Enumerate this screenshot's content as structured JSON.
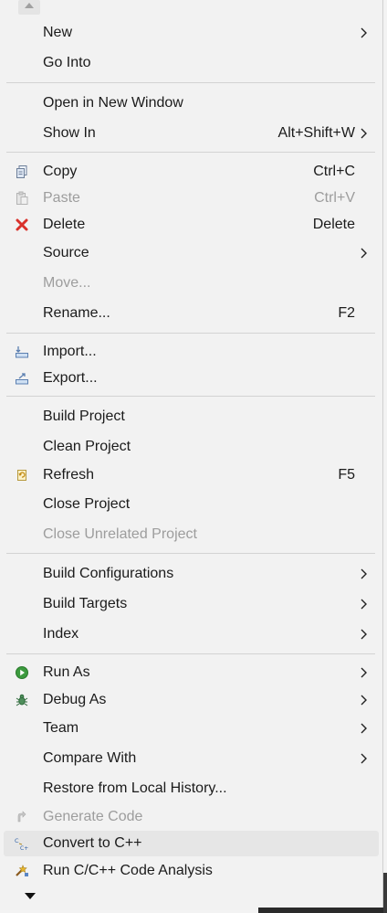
{
  "menu": {
    "items": [
      {
        "label": "New",
        "shortcut": "",
        "submenu": true,
        "disabled": false,
        "icon": ""
      },
      {
        "label": "Go Into",
        "shortcut": "",
        "submenu": false,
        "disabled": false,
        "icon": ""
      },
      {
        "label": "Open in New Window",
        "shortcut": "",
        "submenu": false,
        "disabled": false,
        "icon": ""
      },
      {
        "label": "Show In",
        "shortcut": "Alt+Shift+W",
        "submenu": true,
        "disabled": false,
        "icon": ""
      },
      {
        "label": "Copy",
        "shortcut": "Ctrl+C",
        "submenu": false,
        "disabled": false,
        "icon": "copy-icon"
      },
      {
        "label": "Paste",
        "shortcut": "Ctrl+V",
        "submenu": false,
        "disabled": true,
        "icon": "paste-icon"
      },
      {
        "label": "Delete",
        "shortcut": "Delete",
        "submenu": false,
        "disabled": false,
        "icon": "delete-icon"
      },
      {
        "label": "Source",
        "shortcut": "",
        "submenu": true,
        "disabled": false,
        "icon": ""
      },
      {
        "label": "Move...",
        "shortcut": "",
        "submenu": false,
        "disabled": true,
        "icon": ""
      },
      {
        "label": "Rename...",
        "shortcut": "F2",
        "submenu": false,
        "disabled": false,
        "icon": ""
      },
      {
        "label": "Import...",
        "shortcut": "",
        "submenu": false,
        "disabled": false,
        "icon": "import-icon"
      },
      {
        "label": "Export...",
        "shortcut": "",
        "submenu": false,
        "disabled": false,
        "icon": "export-icon"
      },
      {
        "label": "Build Project",
        "shortcut": "",
        "submenu": false,
        "disabled": false,
        "icon": ""
      },
      {
        "label": "Clean Project",
        "shortcut": "",
        "submenu": false,
        "disabled": false,
        "icon": ""
      },
      {
        "label": "Refresh",
        "shortcut": "F5",
        "submenu": false,
        "disabled": false,
        "icon": "refresh-icon"
      },
      {
        "label": "Close Project",
        "shortcut": "",
        "submenu": false,
        "disabled": false,
        "icon": ""
      },
      {
        "label": "Close Unrelated Project",
        "shortcut": "",
        "submenu": false,
        "disabled": true,
        "icon": ""
      },
      {
        "label": "Build Configurations",
        "shortcut": "",
        "submenu": true,
        "disabled": false,
        "icon": ""
      },
      {
        "label": "Build Targets",
        "shortcut": "",
        "submenu": true,
        "disabled": false,
        "icon": ""
      },
      {
        "label": "Index",
        "shortcut": "",
        "submenu": true,
        "disabled": false,
        "icon": ""
      },
      {
        "label": "Run As",
        "shortcut": "",
        "submenu": true,
        "disabled": false,
        "icon": "run-icon"
      },
      {
        "label": "Debug As",
        "shortcut": "",
        "submenu": true,
        "disabled": false,
        "icon": "debug-bug-icon"
      },
      {
        "label": "Team",
        "shortcut": "",
        "submenu": true,
        "disabled": false,
        "icon": ""
      },
      {
        "label": "Compare With",
        "shortcut": "",
        "submenu": true,
        "disabled": false,
        "icon": ""
      },
      {
        "label": "Restore from Local History...",
        "shortcut": "",
        "submenu": false,
        "disabled": false,
        "icon": ""
      },
      {
        "label": "Generate Code",
        "shortcut": "",
        "submenu": false,
        "disabled": true,
        "icon": "generate-code-icon"
      },
      {
        "label": "Convert to C++",
        "shortcut": "",
        "submenu": false,
        "disabled": false,
        "icon": "convert-cpp-icon",
        "highlighted": true
      },
      {
        "label": "Run C/C++ Code Analysis",
        "shortcut": "",
        "submenu": false,
        "disabled": false,
        "icon": "code-analysis-icon"
      }
    ]
  }
}
